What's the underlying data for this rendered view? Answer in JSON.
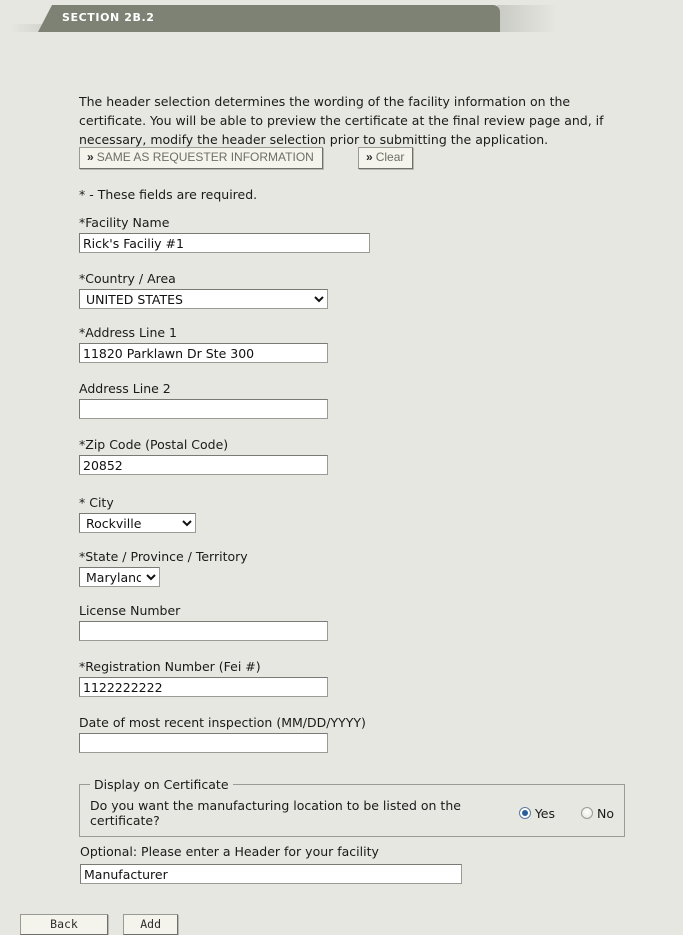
{
  "section": {
    "tab_label": "SECTION 2B.2"
  },
  "intro": {
    "text": "The header selection determines the wording of the facility information on the certificate. You will be able to preview the certificate at the final review page and, if necessary, modify the header selection prior to submitting the application."
  },
  "shortcuts": {
    "chevron": "»",
    "same_as_requester_label": "SAME AS REQUESTER INFORMATION",
    "clear_label": "Clear"
  },
  "form": {
    "required_note": "* - These fields are required.",
    "facility_name": {
      "label": "*Facility Name",
      "value": "Rick's Faciliy #1",
      "placeholder": ""
    },
    "country_area": {
      "label": "*Country / Area",
      "value": "UNITED STATES",
      "options": [
        "UNITED STATES"
      ]
    },
    "address_line_1": {
      "label": "*Address Line 1",
      "value": "11820 Parklawn Dr Ste 300",
      "placeholder": ""
    },
    "address_line_2": {
      "label": "Address Line 2",
      "value": "",
      "placeholder": ""
    },
    "zip_code": {
      "label": "*Zip Code (Postal Code)",
      "value": "20852",
      "placeholder": ""
    },
    "city": {
      "label": "* City",
      "value": "Rockville",
      "options": [
        "Rockville"
      ]
    },
    "state": {
      "label": "*State / Province / Territory",
      "value": "Maryland",
      "options": [
        "Maryland"
      ]
    },
    "license_number": {
      "label": "License Number",
      "value": "",
      "placeholder": ""
    },
    "registration_number": {
      "label": "*Registration Number (Fei #)",
      "value": "1122222222",
      "placeholder": ""
    },
    "inspection_date": {
      "label": "Date of most recent inspection (MM/DD/YYYY)",
      "value": "",
      "placeholder": ""
    }
  },
  "display_on_certificate": {
    "legend": "Display on Certificate",
    "question": "Do you want the manufacturing location to be listed on the certificate?",
    "yes_label": "Yes",
    "no_label": "No",
    "selected": "Yes"
  },
  "footer": {
    "header_label": "Optional: Please enter a Header for your facility",
    "header_value": "Manufacturer",
    "header_placeholder": "",
    "back_label": "Back",
    "add_label": "Add"
  },
  "colors": {
    "page_background": "#e6e7e1",
    "tab_background": "#7d8274",
    "tab_text": "#ffffff",
    "radio_selected": "#2a6099",
    "button_face": "#f4f3ec"
  }
}
